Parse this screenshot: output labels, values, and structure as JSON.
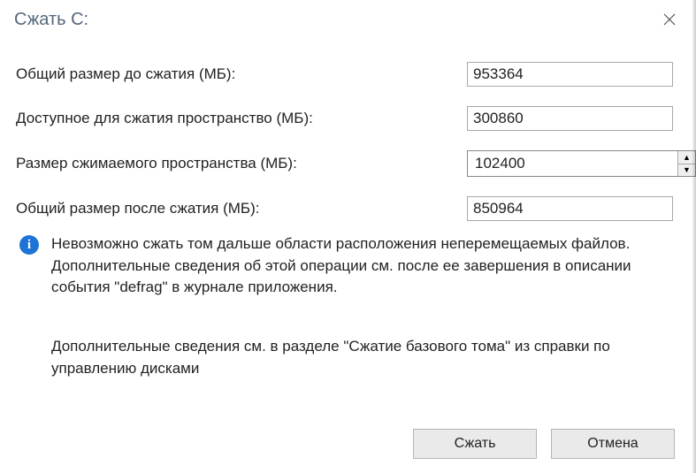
{
  "title": "Сжать C:",
  "labels": {
    "total_before": "Общий размер до сжатия (МБ):",
    "available": "Доступное для сжатия пространство (МБ):",
    "shrink_amount": "Размер сжимаемого пространства (МБ):",
    "total_after": "Общий размер после сжатия (МБ):"
  },
  "values": {
    "total_before": "953364",
    "available": "300860",
    "shrink_amount": "102400",
    "total_after": "850964"
  },
  "info_text": "Невозможно сжать том дальше области расположения неперемещаемых файлов. Дополнительные сведения об этой операции см. после ее завершения в описании события \"defrag\" в журнале приложения.",
  "info_text2": "Дополнительные сведения см. в разделе \"Сжатие базового тома\" из справки по управлению дисками",
  "buttons": {
    "shrink": "Сжать",
    "cancel": "Отмена"
  }
}
